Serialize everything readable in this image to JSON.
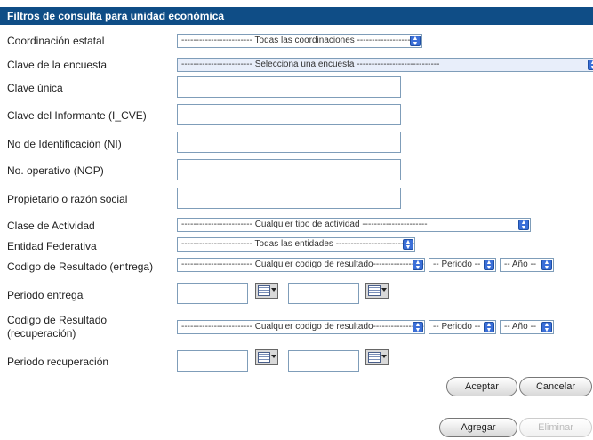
{
  "header": {
    "title": "Filtros de consulta para unidad económica"
  },
  "labels": {
    "coordinacion": "Coordinación estatal",
    "encuesta": "Clave de la encuesta",
    "clave_unica": "Clave única",
    "clave_informante": "Clave del Informante (I_CVE)",
    "no_identificacion": "No de Identificación (NI)",
    "no_operativo": "No. operativo  (NOP)",
    "propietario": "Propietario o razón social",
    "clase_actividad": "Clase de Actividad",
    "entidad": "Entidad Federativa",
    "codigo_entrega": "Codigo de Resultado (entrega)",
    "periodo_entrega": "Periodo entrega",
    "codigo_recuperacion_1": "Codigo de Resultado",
    "codigo_recuperacion_2": "(recuperación)",
    "periodo_recuperacion": "Periodo recuperación"
  },
  "selects": {
    "coordinacion": "------------------------ Todas las coordinaciones ----------------------",
    "encuesta": "------------------------ Selecciona una encuesta ----------------------------",
    "clase_actividad": "------------------------ Cualquier tipo de actividad ----------------------",
    "entidad": "------------------------ Todas las entidades ----------------------------",
    "codigo_entrega": "------------------------ Cualquier codigo de resultado------------------",
    "codigo_recuperacion": "------------------------ Cualquier codigo de resultado------------------",
    "periodo": "-- Periodo --",
    "anio": "-- Año --"
  },
  "buttons": {
    "aceptar": "Aceptar",
    "cancelar": "Cancelar",
    "agregar": "Agregar",
    "eliminar": "Eliminar"
  },
  "colors": {
    "header_bg": "#0f4d86",
    "select_arrow": "#3b6fd8"
  }
}
